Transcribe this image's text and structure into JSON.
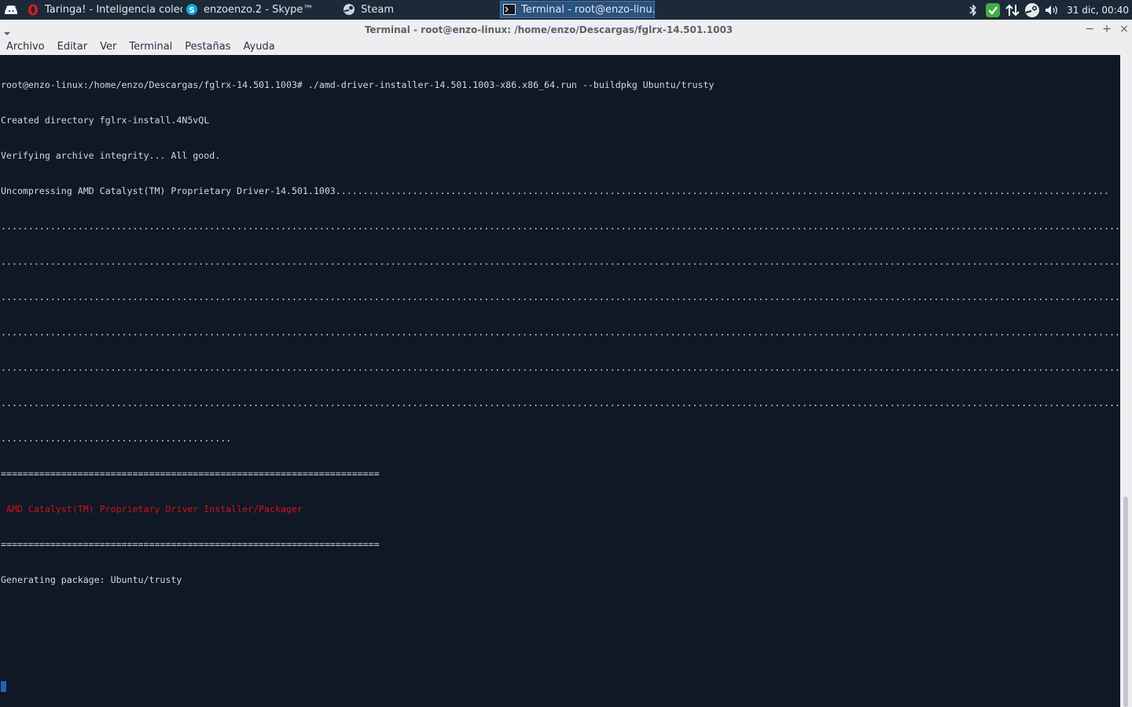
{
  "panel": {
    "app_menu_icon": "whisker-menu-icon",
    "tasks": [
      {
        "icon": "opera-icon",
        "label": "Taringa! - Inteligencia colec..."
      },
      {
        "icon": "skype-icon",
        "label": "enzoenzo.2 - Skype™"
      },
      {
        "icon": "steam-icon",
        "label": "Steam"
      },
      {
        "icon": "terminal-icon",
        "label": "Terminal - root@enzo-linu..."
      }
    ],
    "tray": [
      "bluetooth-icon",
      "update-check-icon",
      "network-icon",
      "steam-tray-icon",
      "volume-icon"
    ],
    "clock": "31 dic, 00:40"
  },
  "window": {
    "title": "Terminal - root@enzo-linux: /home/enzo/Descargas/fglrx-14.501.1003",
    "minimize": "−",
    "maximize": "+",
    "close": "×"
  },
  "menubar": [
    "Archivo",
    "Editar",
    "Ver",
    "Terminal",
    "Pestañas",
    "Ayuda"
  ],
  "terminal": {
    "lines": [
      "root@enzo-linux:/home/enzo/Descargas/fglrx-14.501.1003# ./amd-driver-installer-14.501.1003-x86.x86_64.run --buildpkg Ubuntu/trusty",
      "Created directory fglrx-install.4N5vQL",
      "Verifying archive integrity... All good.",
      "Uncompressing AMD Catalyst(TM) Proprietary Driver-14.501.1003.............................................................................................................................................",
      ".............................................................................................................................................................................................................",
      ".............................................................................................................................................................................................................",
      ".............................................................................................................................................................................................................",
      ".............................................................................................................................................................................................................",
      ".............................................................................................................................................................................................................",
      ".............................................................................................................................................................................................................",
      "..........................................",
      "=====================================================================",
      " AMD Catalyst(TM) Proprietary Driver Installer/Packager",
      "=====================================================================",
      "Generating package: Ubuntu/trusty"
    ]
  },
  "colors": {
    "terminal_bg": "#0f1825",
    "terminal_fg": "#d2d7dc",
    "highlight_red": "#c8151b",
    "cursor": "#2361b3",
    "panel_bg": "#1c2a38"
  }
}
